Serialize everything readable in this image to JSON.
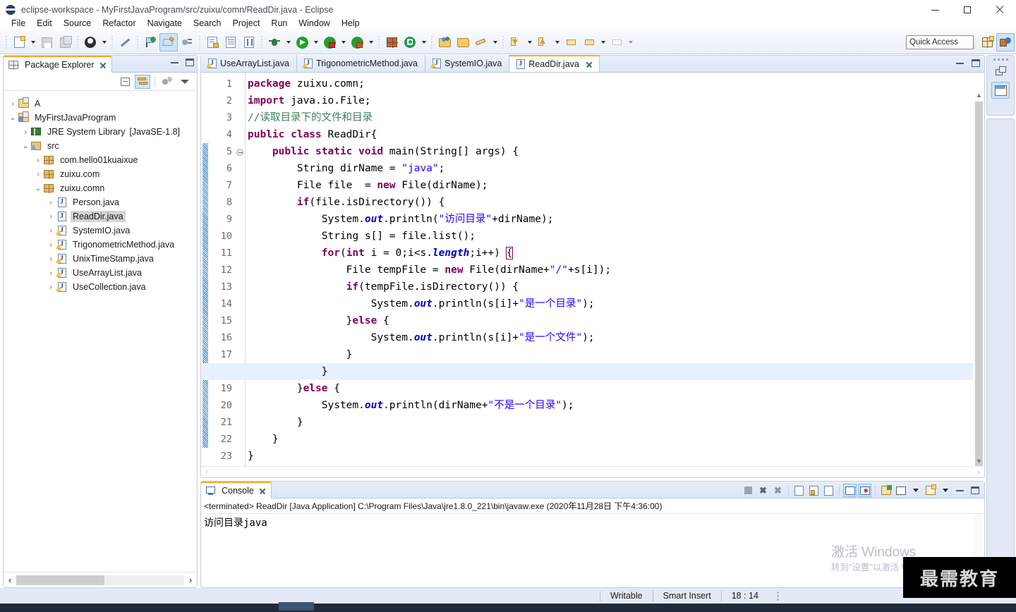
{
  "window": {
    "title": "eclipse-workspace - MyFirstJavaProgram/src/zuixu/comn/ReadDir.java - Eclipse",
    "icon": "eclipse-icon",
    "minimize": "minimize-icon",
    "maximize": "maximize-icon",
    "close": "close-icon"
  },
  "menubar": {
    "items": [
      "File",
      "Edit",
      "Source",
      "Refactor",
      "Navigate",
      "Search",
      "Project",
      "Run",
      "Window",
      "Help"
    ]
  },
  "toolbar": {
    "quick_access_placeholder": "Quick Access",
    "icons": [
      "new-wizard-icon",
      "save-icon",
      "save-all-icon",
      "profile-icon",
      "skip-breakpoints-icon",
      "last-edit-location-icon",
      "edit-highlight-icon",
      "next-annotation-icon",
      "open-type-icon",
      "open-task-icon",
      "toggle-markoccurrences-icon",
      "debug-icon",
      "run-icon",
      "run-external-tools-icon",
      "coverage-icon",
      "new-java-package-icon",
      "new-java-class-icon",
      "open-folder-icon",
      "open-resource-icon",
      "search-icon",
      "forward-icon",
      "back-icon",
      "previous-edit-icon",
      "next-edit-icon"
    ],
    "right_icons": [
      "open-perspective-icon",
      "java-perspective-icon"
    ]
  },
  "package_explorer": {
    "title": "Package Explorer",
    "close_icon": "close-icon",
    "minimize_icon": "minimize-icon",
    "maximize_icon": "maximize-icon",
    "tools": [
      "collapse-all-icon",
      "link-with-editor-icon",
      "view-menu-icon",
      "view-chevron-icon"
    ],
    "tree": [
      {
        "label": "A",
        "icon": "project-icon",
        "indent": 0,
        "twist": "collapsed",
        "selected": false,
        "suffix": ""
      },
      {
        "label": "MyFirstJavaProgram",
        "icon": "java-project-icon",
        "indent": 0,
        "twist": "expanded",
        "selected": false,
        "suffix": ""
      },
      {
        "label": "JRE System Library",
        "icon": "library-icon",
        "indent": 1,
        "twist": "collapsed",
        "selected": false,
        "suffix": "[JavaSE-1.8]"
      },
      {
        "label": "src",
        "icon": "source-folder-icon",
        "indent": 1,
        "twist": "expanded",
        "selected": false,
        "suffix": ""
      },
      {
        "label": "com.hello01kuaixue",
        "icon": "package-icon",
        "indent": 2,
        "twist": "collapsed",
        "selected": false,
        "suffix": ""
      },
      {
        "label": "zuixu.com",
        "icon": "package-icon",
        "indent": 2,
        "twist": "collapsed",
        "selected": false,
        "suffix": ""
      },
      {
        "label": "zuixu.comn",
        "icon": "package-icon",
        "indent": 2,
        "twist": "expanded",
        "selected": false,
        "suffix": ""
      },
      {
        "label": "Person.java",
        "icon": "java-file-icon",
        "indent": 3,
        "twist": "collapsed",
        "selected": false,
        "suffix": ""
      },
      {
        "label": "ReadDir.java",
        "icon": "java-file-icon",
        "indent": 3,
        "twist": "collapsed",
        "selected": true,
        "suffix": ""
      },
      {
        "label": "SystemIO.java",
        "icon": "java-file-warning-icon",
        "indent": 3,
        "twist": "collapsed",
        "selected": false,
        "suffix": ""
      },
      {
        "label": "TrigonometricMethod.java",
        "icon": "java-file-warning-icon",
        "indent": 3,
        "twist": "collapsed",
        "selected": false,
        "suffix": ""
      },
      {
        "label": "UnixTimeStamp.java",
        "icon": "java-file-warning-icon",
        "indent": 3,
        "twist": "collapsed",
        "selected": false,
        "suffix": ""
      },
      {
        "label": "UseArrayList.java",
        "icon": "java-file-warning-icon",
        "indent": 3,
        "twist": "collapsed",
        "selected": false,
        "suffix": ""
      },
      {
        "label": "UseCollection.java",
        "icon": "java-file-warning-icon",
        "indent": 3,
        "twist": "collapsed",
        "selected": false,
        "suffix": ""
      }
    ],
    "hscroll": {
      "left_arrow": "‹",
      "right_arrow": "›"
    }
  },
  "editor": {
    "tabs": [
      {
        "label": "UseArrayList.java",
        "icon": "java-file-warning-icon",
        "active": false,
        "closable": false
      },
      {
        "label": "TrigonometricMethod.java",
        "icon": "java-file-warning-icon",
        "active": false,
        "closable": false
      },
      {
        "label": "SystemIO.java",
        "icon": "java-file-warning-icon",
        "active": false,
        "closable": false
      },
      {
        "label": "ReadDir.java",
        "icon": "java-file-icon",
        "active": true,
        "closable": true
      }
    ],
    "minimize_icon": "minimize-icon",
    "maximize_icon": "maximize-icon",
    "current_line": 18,
    "line_count": 23,
    "lines": [
      {
        "n": 1,
        "fold": false,
        "change": false,
        "tokens": [
          [
            "kw",
            "package"
          ],
          [
            "plain",
            " zuixu.comn;"
          ]
        ]
      },
      {
        "n": 2,
        "fold": false,
        "change": false,
        "tokens": [
          [
            "kw",
            "import"
          ],
          [
            "plain",
            " java.io.File;"
          ]
        ]
      },
      {
        "n": 3,
        "fold": false,
        "change": false,
        "tokens": [
          [
            "cmt",
            "//读取目录下的文件和目录"
          ]
        ]
      },
      {
        "n": 4,
        "fold": false,
        "change": false,
        "tokens": [
          [
            "kw",
            "public class"
          ],
          [
            "plain",
            " ReadDir{"
          ]
        ]
      },
      {
        "n": 5,
        "fold": true,
        "change": true,
        "tokens": [
          [
            "plain",
            "    "
          ],
          [
            "kw",
            "public static void"
          ],
          [
            "plain",
            " main(String[] args) {"
          ]
        ]
      },
      {
        "n": 6,
        "fold": false,
        "change": true,
        "tokens": [
          [
            "plain",
            "        String dirName = "
          ],
          [
            "str",
            "\"java\""
          ],
          [
            "plain",
            ";"
          ]
        ]
      },
      {
        "n": 7,
        "fold": false,
        "change": true,
        "tokens": [
          [
            "plain",
            "        File file  = "
          ],
          [
            "kw",
            "new"
          ],
          [
            "plain",
            " File(dirName);"
          ]
        ]
      },
      {
        "n": 8,
        "fold": false,
        "change": true,
        "tokens": [
          [
            "plain",
            "        "
          ],
          [
            "kw",
            "if"
          ],
          [
            "plain",
            "(file.isDirectory()) {"
          ]
        ]
      },
      {
        "n": 9,
        "fold": false,
        "change": true,
        "tokens": [
          [
            "plain",
            "            System."
          ],
          [
            "fld",
            "out"
          ],
          [
            "plain",
            ".println("
          ],
          [
            "str",
            "\"访问目录\""
          ],
          [
            "plain",
            "+dirName);"
          ]
        ]
      },
      {
        "n": 10,
        "fold": false,
        "change": true,
        "tokens": [
          [
            "plain",
            "            String s[] = file.list();"
          ]
        ]
      },
      {
        "n": 11,
        "fold": false,
        "change": true,
        "tokens": [
          [
            "plain",
            "            "
          ],
          [
            "kw",
            "for"
          ],
          [
            "plain",
            "("
          ],
          [
            "kw",
            "int"
          ],
          [
            "plain",
            " i = 0;i<s."
          ],
          [
            "fld",
            "length"
          ],
          [
            "plain",
            ";i++) "
          ],
          [
            "brmatch",
            "{"
          ]
        ]
      },
      {
        "n": 12,
        "fold": false,
        "change": true,
        "tokens": [
          [
            "plain",
            "                File tempFile = "
          ],
          [
            "kw",
            "new"
          ],
          [
            "plain",
            " File(dirName+"
          ],
          [
            "str",
            "\"/\""
          ],
          [
            "plain",
            "+s[i]);"
          ]
        ]
      },
      {
        "n": 13,
        "fold": false,
        "change": true,
        "tokens": [
          [
            "plain",
            "                "
          ],
          [
            "kw",
            "if"
          ],
          [
            "plain",
            "(tempFile.isDirectory()) {"
          ]
        ]
      },
      {
        "n": 14,
        "fold": false,
        "change": true,
        "tokens": [
          [
            "plain",
            "                    System."
          ],
          [
            "fld",
            "out"
          ],
          [
            "plain",
            ".println(s[i]+"
          ],
          [
            "str",
            "\"是一个目录\""
          ],
          [
            "plain",
            ");"
          ]
        ]
      },
      {
        "n": 15,
        "fold": false,
        "change": true,
        "tokens": [
          [
            "plain",
            "                }"
          ],
          [
            "kw",
            "else"
          ],
          [
            "plain",
            " {"
          ]
        ]
      },
      {
        "n": 16,
        "fold": false,
        "change": true,
        "tokens": [
          [
            "plain",
            "                    System."
          ],
          [
            "fld",
            "out"
          ],
          [
            "plain",
            ".println(s[i]+"
          ],
          [
            "str",
            "\"是一个文件\""
          ],
          [
            "plain",
            ");"
          ]
        ]
      },
      {
        "n": 17,
        "fold": false,
        "change": true,
        "tokens": [
          [
            "plain",
            "                }"
          ]
        ]
      },
      {
        "n": 18,
        "fold": false,
        "change": true,
        "tokens": [
          [
            "plain",
            "            }"
          ]
        ]
      },
      {
        "n": 19,
        "fold": false,
        "change": true,
        "tokens": [
          [
            "plain",
            "        }"
          ],
          [
            "kw",
            "else"
          ],
          [
            "plain",
            " {"
          ]
        ]
      },
      {
        "n": 20,
        "fold": false,
        "change": true,
        "tokens": [
          [
            "plain",
            "            System."
          ],
          [
            "fld",
            "out"
          ],
          [
            "plain",
            ".println(dirName+"
          ],
          [
            "str",
            "\"不是一个目录\""
          ],
          [
            "plain",
            ");"
          ]
        ]
      },
      {
        "n": 21,
        "fold": false,
        "change": true,
        "tokens": [
          [
            "plain",
            "        }"
          ]
        ]
      },
      {
        "n": 22,
        "fold": false,
        "change": true,
        "tokens": [
          [
            "plain",
            "    }"
          ]
        ]
      },
      {
        "n": 23,
        "fold": false,
        "change": false,
        "tokens": [
          [
            "plain",
            "}"
          ]
        ]
      }
    ]
  },
  "console": {
    "title": "Console",
    "close_icon": "close-icon",
    "header": "<terminated> ReadDir [Java Application] C:\\Program Files\\Java\\jre1.8.0_221\\bin\\javaw.exe (2020年11月28日 下午4:36:00)",
    "output": "访问目录java",
    "tools": [
      "terminate-icon",
      "remove-launch-icon",
      "remove-all-terminated-icon",
      "clear-console-icon",
      "scroll-lock-icon",
      "word-wrap-icon",
      "show-console-on-output-icon",
      "show-console-on-error-icon",
      "pin-console-icon",
      "display-selected-console-icon",
      "display-chevron-icon",
      "open-console-icon",
      "open-console-chevron-icon",
      "minimize-icon",
      "maximize-icon"
    ]
  },
  "perspective_bar": {
    "buttons": [
      "open-perspective-icon",
      "java-perspective-icon"
    ]
  },
  "statusbar": {
    "writable": "Writable",
    "insert_mode": "Smart Insert",
    "position": "18 : 14"
  },
  "watermark": {
    "activate_line1": "激活 Windows",
    "activate_line2": "转到\"设置\"以激活 Windows。",
    "brand": "最需教育"
  },
  "colors": {
    "accent": "#f9a825",
    "keyword": "#7f0055",
    "string": "#2a00ff",
    "comment": "#3f7f5f",
    "field": "#0000c0",
    "selection": "#e8f1fb",
    "panel_border": "#c6cedd",
    "statusbar_bg": "#e4e9f7"
  }
}
